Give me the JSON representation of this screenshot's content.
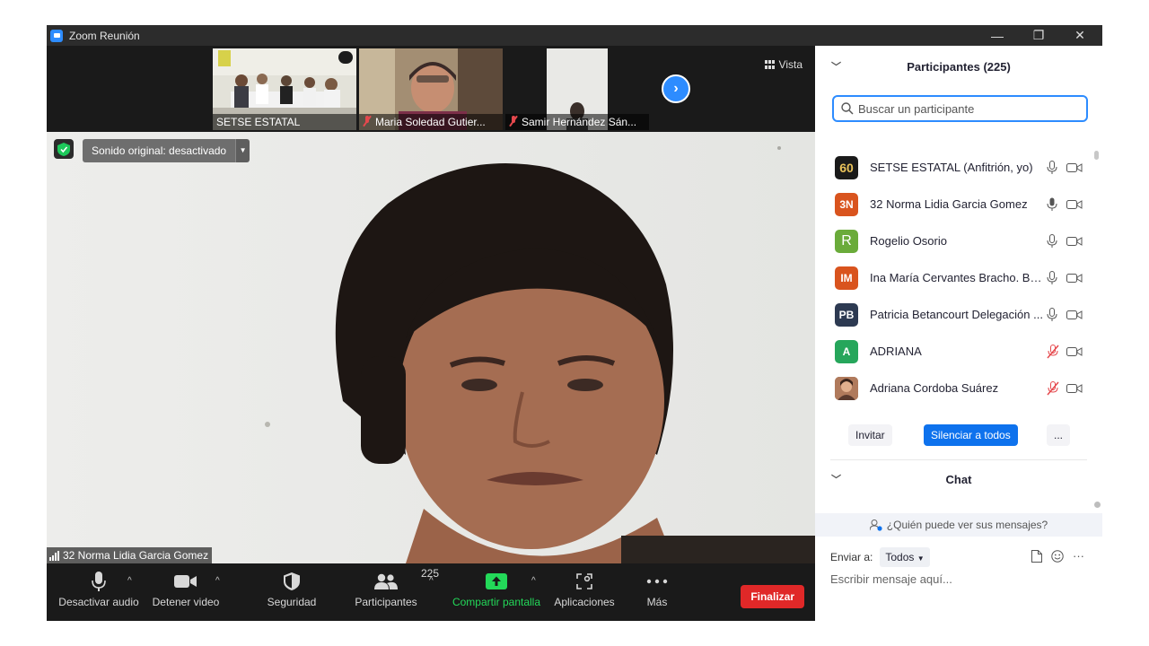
{
  "window": {
    "title": "Zoom Reunión",
    "minimize": "—",
    "maximize": "❐",
    "close": "✕"
  },
  "strip": {
    "thumbs": [
      {
        "name": "SETSE ESTATAL",
        "muted": false
      },
      {
        "name": "Maria Soledad Gutier...",
        "muted": true
      },
      {
        "name": "Samir Hernández Sán...",
        "muted": true
      }
    ],
    "next_label": "›",
    "view_label": "Vista"
  },
  "main_video": {
    "original_sound": "Sonido original: desactivado",
    "speaker_name": "32 Norma Lidia Garcia Gomez"
  },
  "toolbar": {
    "mute_label": "Desactivar audio",
    "video_label": "Detener video",
    "security_label": "Seguridad",
    "participants_label": "Participantes",
    "participants_count": "225",
    "share_label": "Compartir pantalla",
    "apps_label": "Aplicaciones",
    "more_label": "Más",
    "end_label": "Finalizar",
    "share_color": "#23d959",
    "end_color": "#e02828"
  },
  "participants": {
    "title": "Participantes (225)",
    "search_placeholder": "Buscar un participante",
    "items": [
      {
        "initials": "60",
        "name": "SETSE ESTATAL (Anfitrión, yo)",
        "color": "#1a1a1a",
        "muted": false
      },
      {
        "initials": "3N",
        "name": "32 Norma Lidia Garcia Gomez",
        "color": "#d9541e",
        "muted": false
      },
      {
        "initials": "R",
        "name": "Rogelio Osorio",
        "color": "#6aab3a",
        "muted": false
      },
      {
        "initials": "IM",
        "name": "Ina María Cervantes Bracho. Bo...",
        "color": "#d9541e",
        "muted": false
      },
      {
        "initials": "PB",
        "name": "Patricia Betancourt Delegación ...",
        "color": "#2d3a52",
        "muted": false
      },
      {
        "initials": "A",
        "name": "ADRIANA",
        "color": "#26a65b",
        "muted": true
      },
      {
        "initials": "",
        "name": "Adriana Cordoba Suárez",
        "color": "#8a5a44",
        "muted": true
      }
    ],
    "invite_label": "Invitar",
    "mute_all_label": "Silenciar a todos",
    "more_label": "..."
  },
  "chat": {
    "title": "Chat",
    "who_sees": "¿Quién puede ver sus mensajes?",
    "send_to_label": "Enviar a:",
    "send_to_value": "Todos",
    "message_placeholder": "Escribir mensaje aquí...",
    "more_icon": "···"
  }
}
